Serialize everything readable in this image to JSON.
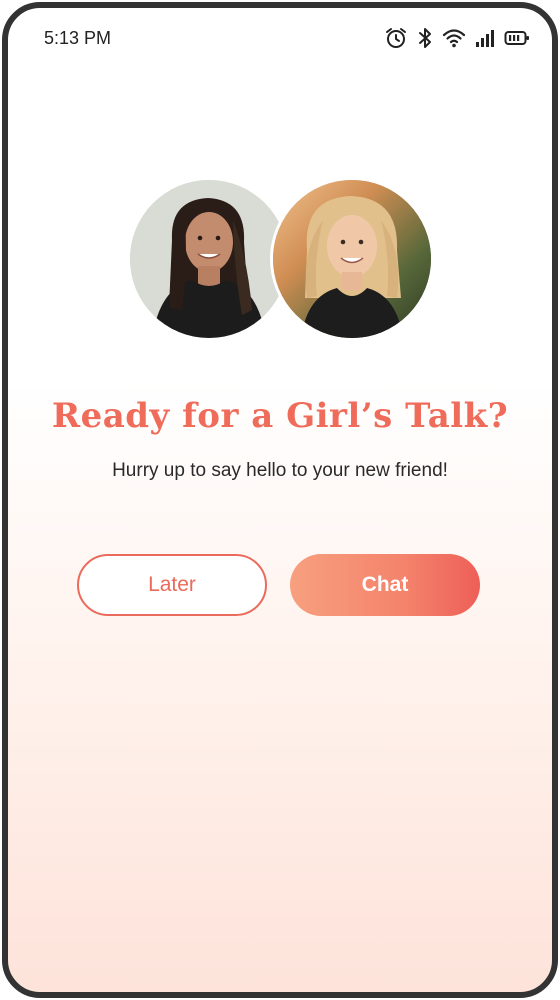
{
  "status_bar": {
    "time": "5:13 PM",
    "icons": [
      "alarm-icon",
      "bluetooth-icon",
      "wifi-icon",
      "signal-icon",
      "battery-icon"
    ]
  },
  "match": {
    "avatars": [
      "avatar-user",
      "avatar-friend"
    ],
    "title": "Ready for a Girl’s Talk?",
    "subtitle": "Hurry up to say hello to your new friend!"
  },
  "actions": {
    "later_label": "Later",
    "chat_label": "Chat"
  },
  "colors": {
    "accent": "#ef6b5a",
    "chat_gradient_start": "#f7a07f",
    "chat_gradient_end": "#ee5f58",
    "frame": "#333333"
  }
}
